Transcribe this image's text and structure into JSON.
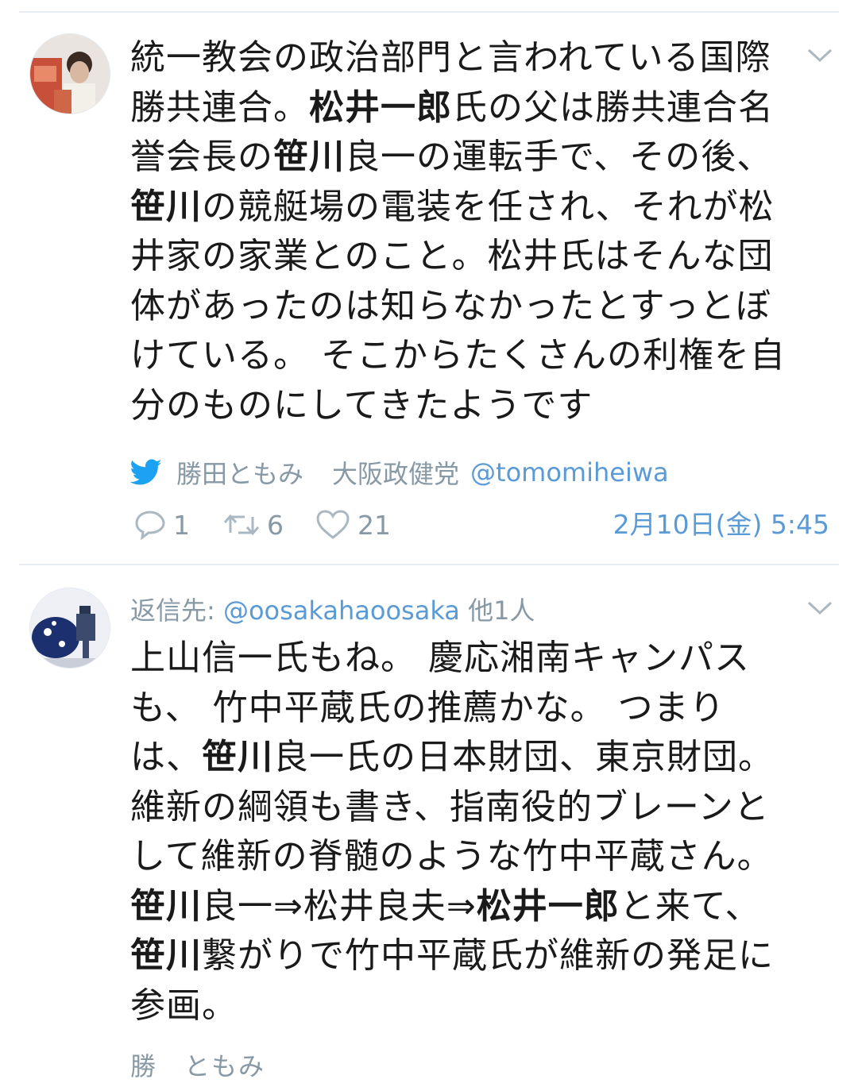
{
  "tweets": [
    {
      "reply_prefix": "",
      "reply_handle": "",
      "reply_suffix": "",
      "segments": [
        {
          "t": "統一教会の政治部門と言われている国際勝共連合。",
          "b": false
        },
        {
          "t": "松井一郎",
          "b": true
        },
        {
          "t": "氏の父は勝共連合名誉会長の",
          "b": false
        },
        {
          "t": "笹川",
          "b": true
        },
        {
          "t": "良一の運転手で、その後、",
          "b": false
        },
        {
          "t": "笹川",
          "b": true
        },
        {
          "t": "の競艇場の電装を任され、それが松井家の家業とのこと。松井氏はそんな団体があったのは知らなかったとすっとぼけている。 そこからたくさんの利権を自分のものにしてきたようです",
          "b": false
        }
      ],
      "author_name": "勝田ともみ",
      "author_party": "大阪政健党",
      "author_handle": "@tomomiheiwa",
      "replies": "1",
      "retweets": "6",
      "likes": "21",
      "timestamp": "2月10日(金) 5:45"
    },
    {
      "reply_prefix": "返信先: ",
      "reply_handle": "@oosakahaoosaka",
      "reply_suffix": " 他1人",
      "segments": [
        {
          "t": "上山信一氏もね。 慶応湘南キャンパスも、 竹中平蔵氏の推薦かな。 つまりは、",
          "b": false
        },
        {
          "t": "笹川",
          "b": true
        },
        {
          "t": "良一氏の日本財団、東京財団。 維新の綱領も書き、指南役的ブレーンとして維新の脊髄のような竹中平蔵さん。 ",
          "b": false
        },
        {
          "t": "笹川",
          "b": true
        },
        {
          "t": "良一⇒松井良夫⇒",
          "b": false
        },
        {
          "t": "松井一郎",
          "b": true
        },
        {
          "t": "と来て、 ",
          "b": false
        },
        {
          "t": "笹川",
          "b": true
        },
        {
          "t": "繋がりで竹中平蔵氏が維新の発足に参画。",
          "b": false
        }
      ]
    }
  ],
  "cut_text": "勝　ともみ",
  "colors": {
    "link": "#5b9bd5",
    "muted": "#8899a6",
    "twitter_blue": "#1da1f2",
    "divider": "#e6ecf0"
  }
}
